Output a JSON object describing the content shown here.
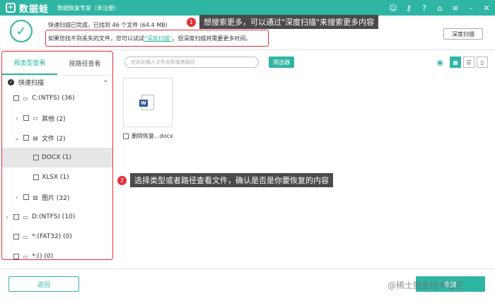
{
  "app": {
    "logo_mark": "+",
    "name": "数据蛙",
    "subtitle": "数据恢复专家（未注册）"
  },
  "top_icons": [
    "user-icon",
    "key-icon",
    "help-icon",
    "home-icon",
    "menu-icon",
    "minimize-icon",
    "close-icon"
  ],
  "top_icon_glyphs": [
    "☺",
    "⚷",
    "?",
    "⌂",
    "≡",
    "–",
    "✕"
  ],
  "status": {
    "check_glyph": "✓",
    "line1": "快速扫描已完成，已找到 46 个文件 (64.4 MB)",
    "line2_prefix": "如果您找不到丢失的文件，您可以试试",
    "line2_link": "\"深度扫描\"",
    "line2_suffix": "。但深度扫描将需要更多时间。",
    "deep_scan_button": "深度扫描"
  },
  "callouts": [
    {
      "num": "1",
      "text": "想搜索更多，可以通过\"深度扫描\"来搜索更多内容"
    },
    {
      "num": "2",
      "text": "选择类型或者路径查看文件，确认是否是你要恢复的内容"
    }
  ],
  "sidebar": {
    "tabs": [
      "按类型查看",
      "按路径查看"
    ],
    "quick_scan": "快速扫描",
    "tree": [
      {
        "arrow": "",
        "icon": "▭",
        "label": "C:(NTFS) (36)"
      },
      {
        "arrow": "›",
        "icon": "▭",
        "label": "其他 (2)"
      },
      {
        "arrow": "⌄",
        "icon": "▤",
        "label": "文件 (2)"
      },
      {
        "arrow": "",
        "icon": "",
        "label": "DOCX (1)"
      },
      {
        "arrow": "",
        "icon": "",
        "label": "XLSX (1)"
      },
      {
        "arrow": "›",
        "icon": "▨",
        "label": "图片 (32)"
      },
      {
        "arrow": "›",
        "icon": "▭",
        "label": "D:(NTFS) (10)"
      },
      {
        "arrow": "",
        "icon": "▭",
        "label": "*:(FAT32) (0)"
      },
      {
        "arrow": "",
        "icon": "▭",
        "label": "*:() (0)"
      }
    ]
  },
  "toolbar": {
    "search_placeholder": "在此处输入文件名称或者路径",
    "filter_button": "筛选器",
    "view_glyphs": [
      "▦",
      "☰",
      "▯"
    ]
  },
  "files": [
    {
      "icon_letter": "W",
      "name": "删除恢复...docx"
    }
  ],
  "footer": {
    "back_button": "返回",
    "recover_button": "恢复",
    "watermark": "@稀土掘金技术社区"
  }
}
